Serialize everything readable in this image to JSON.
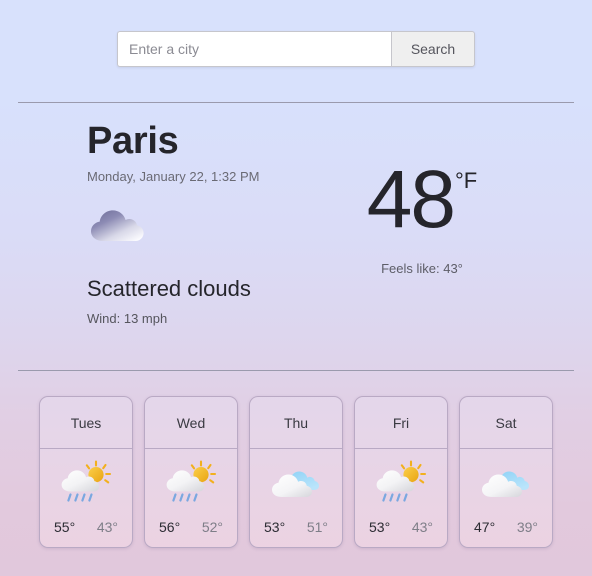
{
  "search": {
    "placeholder": "Enter a city",
    "value": "",
    "button_label": "Search"
  },
  "current": {
    "city": "Paris",
    "datetime": "Monday, January 22, 1:32 PM",
    "icon": "cloud-icon",
    "condition": "Scattered clouds",
    "wind": "Wind: 13 mph",
    "temperature": "48",
    "unit": "°F",
    "feels_like": "Feels like: 43°"
  },
  "forecast": [
    {
      "day": "Tues",
      "icon": "sun-cloud-rain-icon",
      "high": "55°",
      "low": "43°"
    },
    {
      "day": "Wed",
      "icon": "sun-cloud-rain-icon",
      "high": "56°",
      "low": "52°"
    },
    {
      "day": "Thu",
      "icon": "cloud-blue-icon",
      "high": "53°",
      "low": "51°"
    },
    {
      "day": "Fri",
      "icon": "sun-cloud-rain-icon",
      "high": "53°",
      "low": "43°"
    },
    {
      "day": "Sat",
      "icon": "cloud-blue-icon",
      "high": "47°",
      "low": "39°"
    }
  ],
  "colors": {
    "background_top": "#d8e1fc",
    "background_bottom": "#e1c8dc",
    "divider": "#9a9aad",
    "card_border": "#b9a9c4",
    "text_primary": "#25252b",
    "text_secondary": "#6a6a74",
    "sun": "#f2b01e",
    "rain": "#7aa8e0"
  }
}
